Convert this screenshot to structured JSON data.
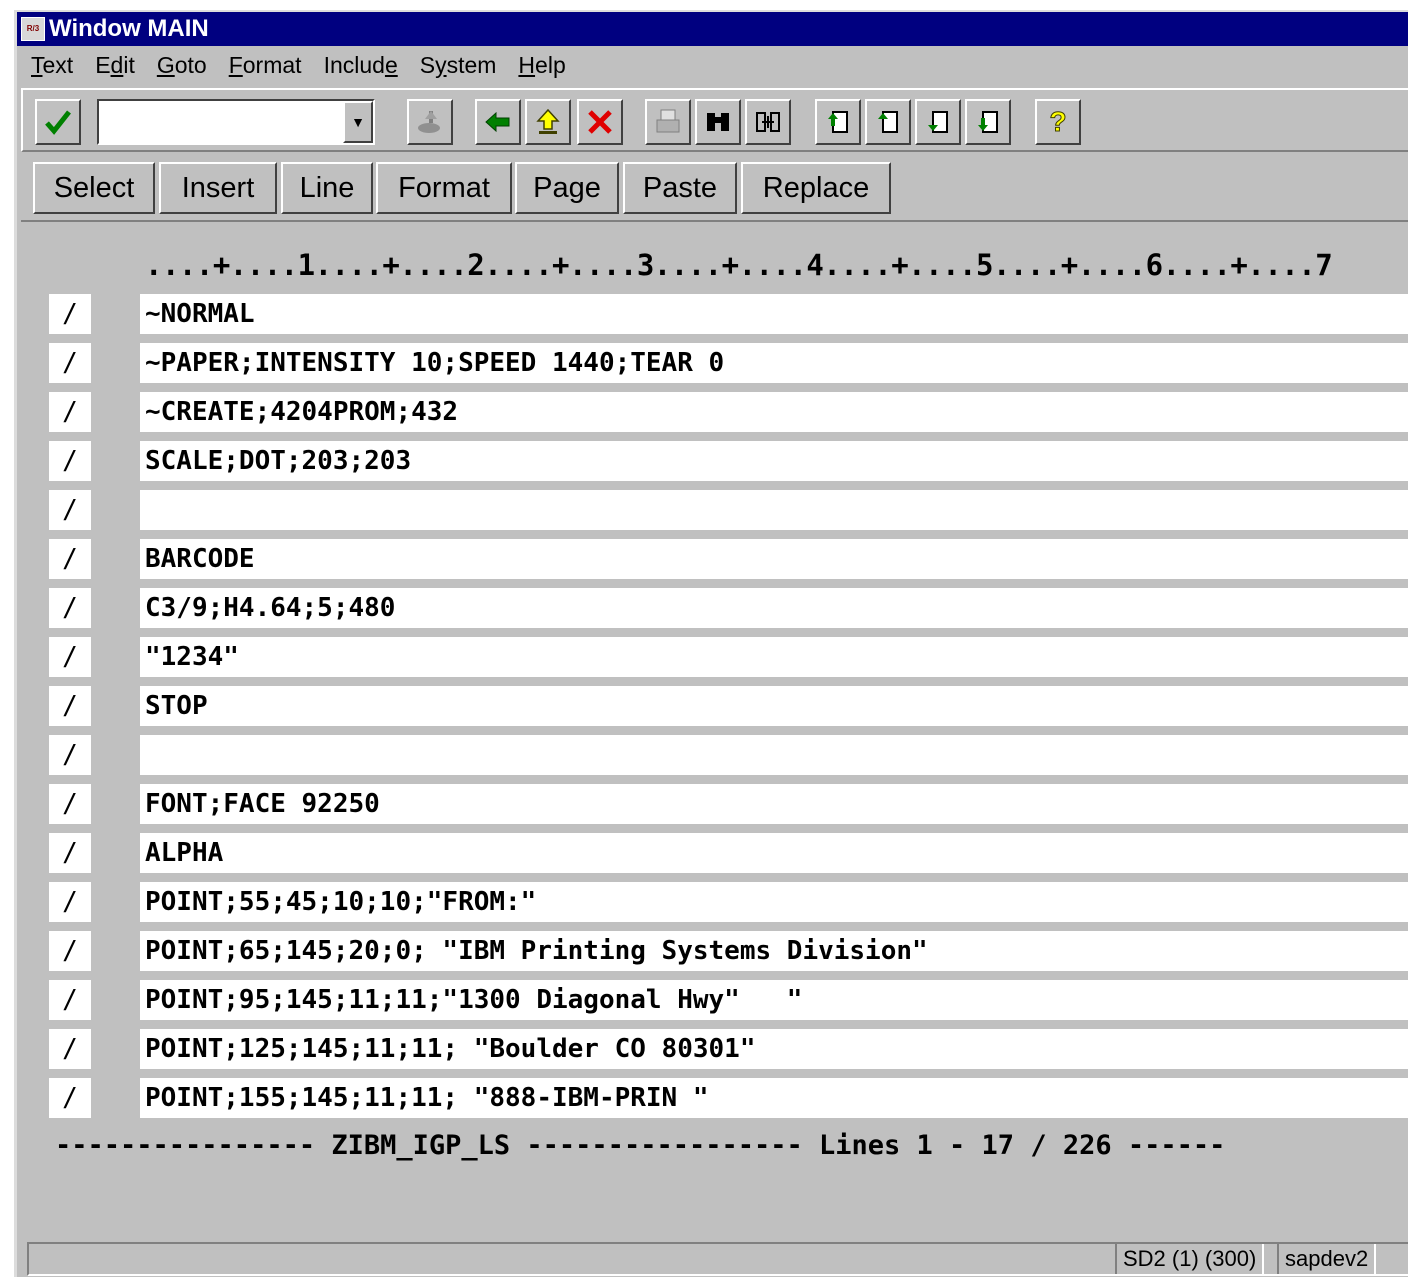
{
  "window": {
    "title": "Window MAIN",
    "app_icon": "R/3"
  },
  "menu": [
    {
      "key": "T",
      "rest": "ext"
    },
    {
      "pre": "E",
      "key": "d",
      "rest": "it"
    },
    {
      "key": "G",
      "rest": "oto"
    },
    {
      "key": "F",
      "rest": "ormat"
    },
    {
      "pre": "Includ",
      "key": "e",
      "rest": ""
    },
    {
      "pre": "S",
      "key": "y",
      "rest": "stem"
    },
    {
      "key": "H",
      "rest": "elp"
    }
  ],
  "toolbar": {
    "command_value": "",
    "icons": [
      "check-icon",
      "save-icon",
      "back-icon",
      "exit-icon",
      "cancel-icon",
      "print-icon",
      "find-icon",
      "find-next-icon",
      "first-page-icon",
      "prev-page-icon",
      "next-page-icon",
      "last-page-icon",
      "help-icon"
    ]
  },
  "app_toolbar": [
    "Select",
    "Insert",
    "Line",
    "Format",
    "Page",
    "Paste",
    "Replace"
  ],
  "ruler": "....+....1....+....2....+....3....+....4....+....5....+....6....+....7",
  "editor": {
    "marker": "/",
    "lines": [
      "~NORMAL",
      "~PAPER;INTENSITY 10;SPEED 1440;TEAR 0",
      "~CREATE;4204PROM;432",
      "SCALE;DOT;203;203",
      "",
      "BARCODE",
      "C3/9;H4.64;5;480",
      "\"1234\"",
      "STOP",
      "",
      "FONT;FACE 92250",
      "ALPHA",
      "POINT;55;45;10;10;\"FROM:\"",
      "POINT;65;145;20;0; \"IBM Printing Systems Division\"",
      "POINT;95;145;11;11;\"1300 Diagonal Hwy\"   \"",
      "POINT;125;145;11;11; \"Boulder CO 80301\"",
      "POINT;155;145;11;11; \"888-IBM-PRIN \""
    ]
  },
  "footer": "---------------- ZIBM_IGP_LS ----------------- Lines 1 - 17 / 226 ------",
  "status": {
    "system": "SD2 (1) (300)",
    "server": "sapdev2"
  }
}
